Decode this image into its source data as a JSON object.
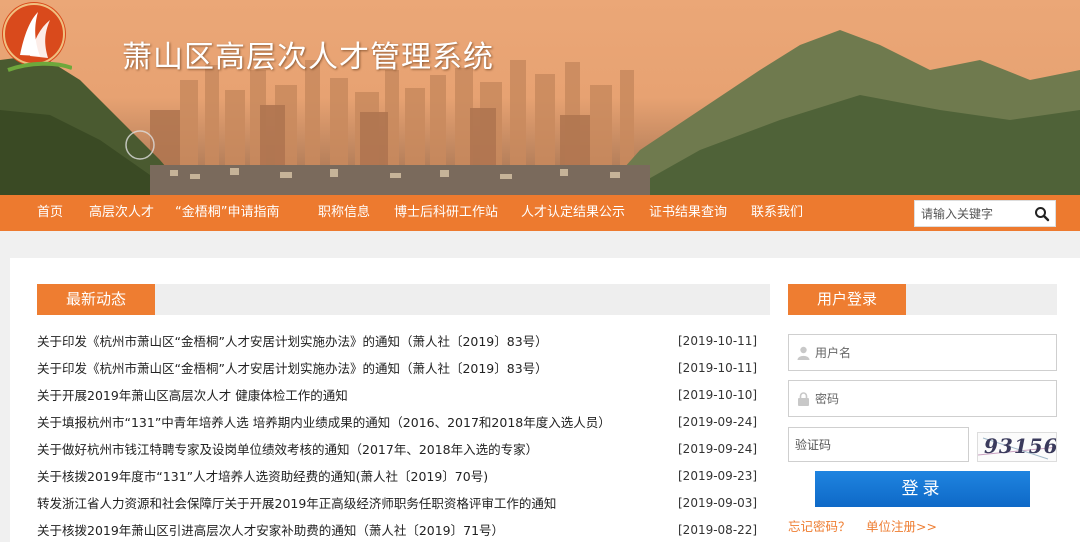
{
  "header": {
    "site_title": "萧山区高层次人才管理系统"
  },
  "nav": {
    "items": [
      {
        "label": "首页"
      },
      {
        "label": "高层次人才"
      },
      {
        "label": "“金梧桐”申请指南"
      },
      {
        "label": "职称信息"
      },
      {
        "label": "博士后科研工作站"
      },
      {
        "label": "人才认定结果公示"
      },
      {
        "label": "证书结果查询"
      },
      {
        "label": "联系我们"
      }
    ],
    "search_placeholder": "请输入关键字",
    "search_icon": "search-icon"
  },
  "news": {
    "tab_label": "最新动态",
    "items": [
      {
        "title": "关于印发《杭州市萧山区“金梧桐”人才安居计划实施办法》的通知（萧人社〔2019〕83号）",
        "date": "[2019-10-11]"
      },
      {
        "title": "关于印发《杭州市萧山区“金梧桐”人才安居计划实施办法》的通知（萧人社〔2019〕83号）",
        "date": "[2019-10-11]"
      },
      {
        "title": "关于开展2019年萧山区高层次人才 健康体检工作的通知",
        "date": "[2019-10-10]"
      },
      {
        "title": "关于填报杭州市“131”中青年培养人选 培养期内业绩成果的通知（2016、2017和2018年度入选人员）",
        "date": "[2019-09-24]"
      },
      {
        "title": "关于做好杭州市钱江特聘专家及设岗单位绩效考核的通知（2017年、2018年入选的专家）",
        "date": "[2019-09-24]"
      },
      {
        "title": "关于核拨2019年度市“131”人才培养人选资助经费的通知(萧人社〔2019〕70号)",
        "date": "[2019-09-23]"
      },
      {
        "title": "转发浙江省人力资源和社会保障厅关于开展2019年正高级经济师职务任职资格评审工作的通知",
        "date": "[2019-09-03]"
      },
      {
        "title": "关于核拨2019年萧山区引进高层次人才安家补助费的通知（萧人社〔2019〕71号）",
        "date": "[2019-08-22]"
      }
    ]
  },
  "login": {
    "tab_label": "用户登录",
    "username_placeholder": "用户名",
    "password_placeholder": "密码",
    "captcha_placeholder": "验证码",
    "captcha_text": "93156",
    "login_button": "登录",
    "forgot_password": "忘记密码？",
    "register": "单位注册>>"
  },
  "colors": {
    "accent_orange": "#ee7d31",
    "nav_orange": "#ed7a2f",
    "button_blue": "#1277d6"
  }
}
